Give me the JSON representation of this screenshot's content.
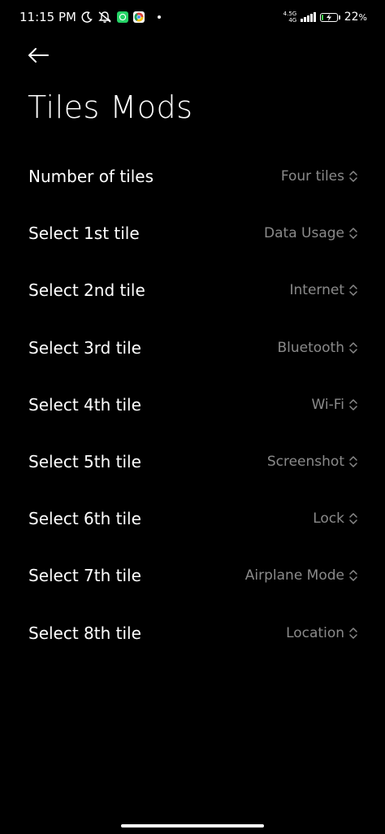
{
  "status_bar": {
    "time": "11:15 PM",
    "network_line1": "4.5G",
    "network_line2": "4G",
    "battery_percent": "22",
    "battery_unit": "%",
    "battery_level": 0.22,
    "icons": [
      "moon-icon",
      "muted-bell-icon",
      "whatsapp-icon",
      "chrome-icon",
      "signal-icon",
      "battery-charging-icon"
    ]
  },
  "header": {
    "back_icon": "arrow-left-icon",
    "title": "Tiles Mods"
  },
  "settings": [
    {
      "label": "Number of tiles",
      "value": "Four tiles"
    },
    {
      "label": "Select 1st tile",
      "value": "Data Usage"
    },
    {
      "label": "Select 2nd tile",
      "value": "Internet"
    },
    {
      "label": "Select 3rd tile",
      "value": "Bluetooth"
    },
    {
      "label": "Select 4th tile",
      "value": "Wi-Fi"
    },
    {
      "label": "Select 5th tile",
      "value": "Screenshot"
    },
    {
      "label": "Select 6th tile",
      "value": "Lock"
    },
    {
      "label": "Select 7th tile",
      "value": "Airplane Mode"
    },
    {
      "label": "Select 8th tile",
      "value": "Location"
    }
  ],
  "colors": {
    "background": "#000000",
    "primary_text": "#ffffff",
    "secondary_text": "#8a8a8a",
    "battery_charge": "#3fd24a",
    "whatsapp": "#25d366"
  }
}
